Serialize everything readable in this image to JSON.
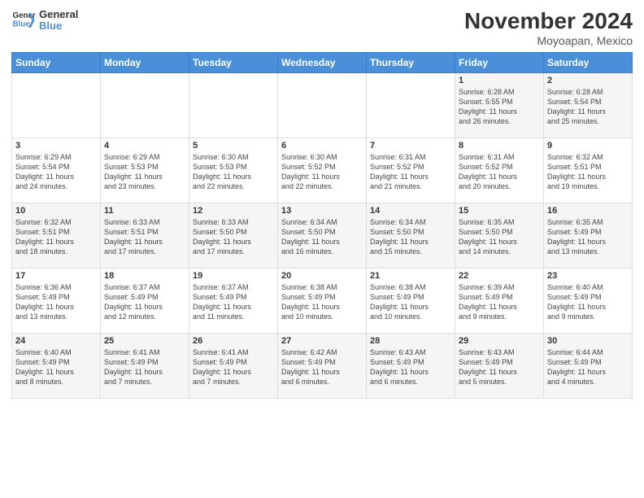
{
  "logo": {
    "line1": "General",
    "line2": "Blue"
  },
  "title": "November 2024",
  "subtitle": "Moyoapan, Mexico",
  "days_of_week": [
    "Sunday",
    "Monday",
    "Tuesday",
    "Wednesday",
    "Thursday",
    "Friday",
    "Saturday"
  ],
  "weeks": [
    [
      {
        "day": "",
        "info": ""
      },
      {
        "day": "",
        "info": ""
      },
      {
        "day": "",
        "info": ""
      },
      {
        "day": "",
        "info": ""
      },
      {
        "day": "",
        "info": ""
      },
      {
        "day": "1",
        "info": "Sunrise: 6:28 AM\nSunset: 5:55 PM\nDaylight: 11 hours\nand 26 minutes."
      },
      {
        "day": "2",
        "info": "Sunrise: 6:28 AM\nSunset: 5:54 PM\nDaylight: 11 hours\nand 25 minutes."
      }
    ],
    [
      {
        "day": "3",
        "info": "Sunrise: 6:29 AM\nSunset: 5:54 PM\nDaylight: 11 hours\nand 24 minutes."
      },
      {
        "day": "4",
        "info": "Sunrise: 6:29 AM\nSunset: 5:53 PM\nDaylight: 11 hours\nand 23 minutes."
      },
      {
        "day": "5",
        "info": "Sunrise: 6:30 AM\nSunset: 5:53 PM\nDaylight: 11 hours\nand 22 minutes."
      },
      {
        "day": "6",
        "info": "Sunrise: 6:30 AM\nSunset: 5:52 PM\nDaylight: 11 hours\nand 22 minutes."
      },
      {
        "day": "7",
        "info": "Sunrise: 6:31 AM\nSunset: 5:52 PM\nDaylight: 11 hours\nand 21 minutes."
      },
      {
        "day": "8",
        "info": "Sunrise: 6:31 AM\nSunset: 5:52 PM\nDaylight: 11 hours\nand 20 minutes."
      },
      {
        "day": "9",
        "info": "Sunrise: 6:32 AM\nSunset: 5:51 PM\nDaylight: 11 hours\nand 19 minutes."
      }
    ],
    [
      {
        "day": "10",
        "info": "Sunrise: 6:32 AM\nSunset: 5:51 PM\nDaylight: 11 hours\nand 18 minutes."
      },
      {
        "day": "11",
        "info": "Sunrise: 6:33 AM\nSunset: 5:51 PM\nDaylight: 11 hours\nand 17 minutes."
      },
      {
        "day": "12",
        "info": "Sunrise: 6:33 AM\nSunset: 5:50 PM\nDaylight: 11 hours\nand 17 minutes."
      },
      {
        "day": "13",
        "info": "Sunrise: 6:34 AM\nSunset: 5:50 PM\nDaylight: 11 hours\nand 16 minutes."
      },
      {
        "day": "14",
        "info": "Sunrise: 6:34 AM\nSunset: 5:50 PM\nDaylight: 11 hours\nand 15 minutes."
      },
      {
        "day": "15",
        "info": "Sunrise: 6:35 AM\nSunset: 5:50 PM\nDaylight: 11 hours\nand 14 minutes."
      },
      {
        "day": "16",
        "info": "Sunrise: 6:35 AM\nSunset: 5:49 PM\nDaylight: 11 hours\nand 13 minutes."
      }
    ],
    [
      {
        "day": "17",
        "info": "Sunrise: 6:36 AM\nSunset: 5:49 PM\nDaylight: 11 hours\nand 13 minutes."
      },
      {
        "day": "18",
        "info": "Sunrise: 6:37 AM\nSunset: 5:49 PM\nDaylight: 11 hours\nand 12 minutes."
      },
      {
        "day": "19",
        "info": "Sunrise: 6:37 AM\nSunset: 5:49 PM\nDaylight: 11 hours\nand 11 minutes."
      },
      {
        "day": "20",
        "info": "Sunrise: 6:38 AM\nSunset: 5:49 PM\nDaylight: 11 hours\nand 10 minutes."
      },
      {
        "day": "21",
        "info": "Sunrise: 6:38 AM\nSunset: 5:49 PM\nDaylight: 11 hours\nand 10 minutes."
      },
      {
        "day": "22",
        "info": "Sunrise: 6:39 AM\nSunset: 5:49 PM\nDaylight: 11 hours\nand 9 minutes."
      },
      {
        "day": "23",
        "info": "Sunrise: 6:40 AM\nSunset: 5:49 PM\nDaylight: 11 hours\nand 9 minutes."
      }
    ],
    [
      {
        "day": "24",
        "info": "Sunrise: 6:40 AM\nSunset: 5:49 PM\nDaylight: 11 hours\nand 8 minutes."
      },
      {
        "day": "25",
        "info": "Sunrise: 6:41 AM\nSunset: 5:49 PM\nDaylight: 11 hours\nand 7 minutes."
      },
      {
        "day": "26",
        "info": "Sunrise: 6:41 AM\nSunset: 5:49 PM\nDaylight: 11 hours\nand 7 minutes."
      },
      {
        "day": "27",
        "info": "Sunrise: 6:42 AM\nSunset: 5:49 PM\nDaylight: 11 hours\nand 6 minutes."
      },
      {
        "day": "28",
        "info": "Sunrise: 6:43 AM\nSunset: 5:49 PM\nDaylight: 11 hours\nand 6 minutes."
      },
      {
        "day": "29",
        "info": "Sunrise: 6:43 AM\nSunset: 5:49 PM\nDaylight: 11 hours\nand 5 minutes."
      },
      {
        "day": "30",
        "info": "Sunrise: 6:44 AM\nSunset: 5:49 PM\nDaylight: 11 hours\nand 4 minutes."
      }
    ]
  ]
}
